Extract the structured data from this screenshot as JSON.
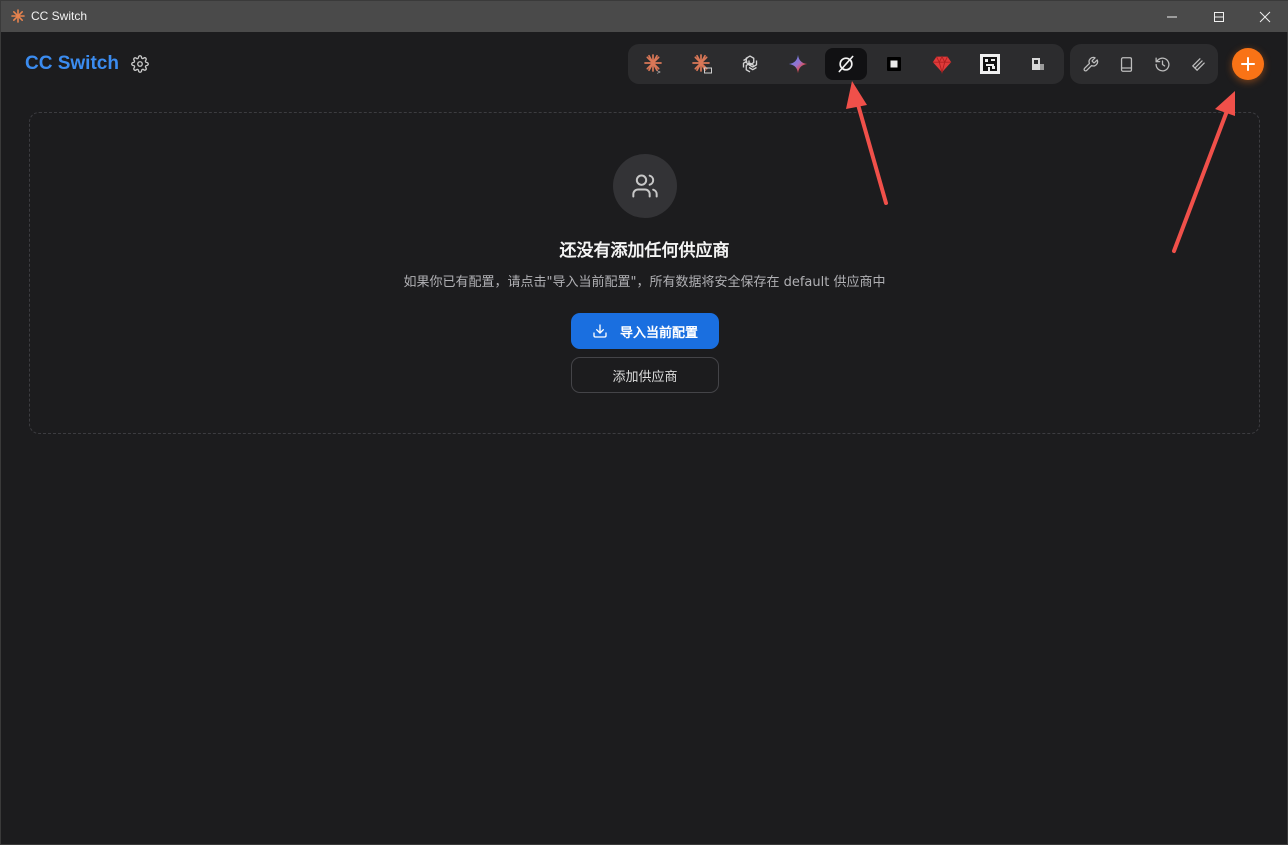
{
  "window": {
    "title": "CC Switch",
    "controls": [
      "minimize-icon",
      "maximize-icon",
      "close-icon"
    ]
  },
  "header": {
    "brand": "CC Switch",
    "settings_icon": "gear-icon",
    "apps": [
      {
        "name": "claude-code-icon",
        "active": false
      },
      {
        "name": "claude-desktop-icon",
        "active": false
      },
      {
        "name": "openai-codex-icon",
        "active": false
      },
      {
        "name": "gemini-icon",
        "active": false
      },
      {
        "name": "opencode-icon",
        "active": true
      },
      {
        "name": "square-app-icon",
        "active": false
      },
      {
        "name": "red-gem-icon",
        "active": false
      },
      {
        "name": "pixel-avatar-icon",
        "active": false
      },
      {
        "name": "pixel-logo-icon",
        "active": false
      }
    ],
    "tools": [
      "wrench-icon",
      "book-icon",
      "history-icon",
      "layers-icon"
    ],
    "add_icon": "plus-icon"
  },
  "empty_state": {
    "icon": "users-icon",
    "title": "还没有添加任何供应商",
    "description": "如果你已有配置，请点击\"导入当前配置\"，所有数据将安全保存在 default 供应商中",
    "import_button": "导入当前配置",
    "add_button": "添加供应商"
  },
  "colors": {
    "accent_blue": "#1a6fe0",
    "brand_blue": "#3b8cf0",
    "add_orange": "#f97316",
    "annotation_red": "#f0504a"
  }
}
